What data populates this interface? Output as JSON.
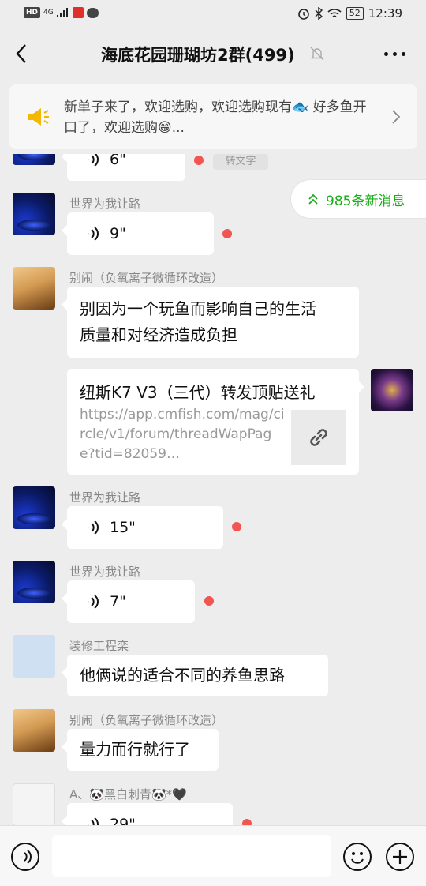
{
  "status_bar": {
    "hd": "HD",
    "network": "4G",
    "battery": "52",
    "time": "12:39"
  },
  "header": {
    "title": "海底花园珊瑚坊2群(499)"
  },
  "notice": {
    "text": "新单子来了，欢迎选购，欢迎选购现有🐟 好多鱼开口了，欢迎选购😁..."
  },
  "new_messages": {
    "label": "985条新消息"
  },
  "messages": [
    {
      "type": "voice",
      "sender": "",
      "duration": "6\"",
      "tag": "转文字"
    },
    {
      "type": "voice",
      "sender": "世界为我让路",
      "duration": "9\""
    },
    {
      "type": "text",
      "sender": "别闹（负氧离子微循环改造）",
      "text_line1": "别因为一个玩鱼而影响自己的生活",
      "text_line2": "质量和对经济造成负担"
    },
    {
      "type": "link",
      "sender": "",
      "title": "纽斯K7 V3（三代）转发顶贴送礼",
      "url": "https://app.cmfish.com/mag/circle/v1/forum/threadWapPage?tid=82059…"
    },
    {
      "type": "voice",
      "sender": "世界为我让路",
      "duration": "15\""
    },
    {
      "type": "voice",
      "sender": "世界为我让路",
      "duration": "7\""
    },
    {
      "type": "text",
      "sender": "装修工程栾",
      "text_line1": "他俩说的适合不同的养鱼思路"
    },
    {
      "type": "text",
      "sender": "别闹（负氧离子微循环改造）",
      "text_line1": "量力而行就行了"
    },
    {
      "type": "voice",
      "sender": "A、🐼黑白刺青🐼*🖤",
      "duration": "29\""
    }
  ],
  "colors": {
    "background": "#ededed",
    "unread_dot": "#f25451",
    "accent_green": "#1aad19"
  }
}
